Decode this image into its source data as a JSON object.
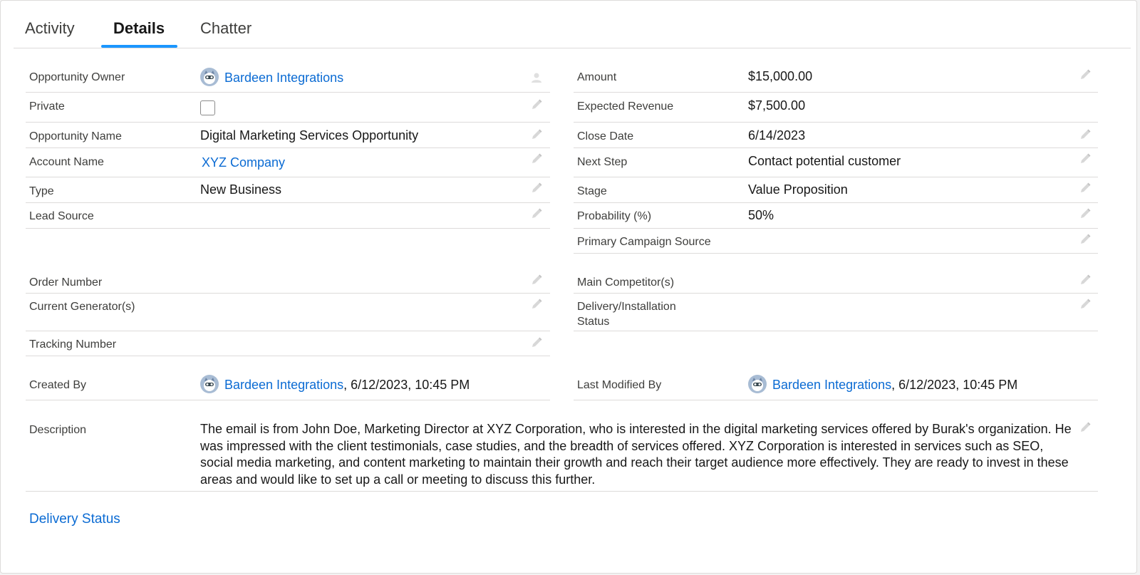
{
  "tabs": [
    {
      "label": "Activity"
    },
    {
      "label": "Details"
    },
    {
      "label": "Chatter"
    }
  ],
  "left": {
    "owner_label": "Opportunity Owner",
    "owner_value": "Bardeen Integrations",
    "private_label": "Private",
    "opp_name_label": "Opportunity Name",
    "opp_name_value": "Digital Marketing Services Opportunity",
    "account_label": "Account Name",
    "account_value": "XYZ Company",
    "type_label": "Type",
    "type_value": "New Business",
    "lead_label": "Lead Source",
    "lead_value": "",
    "order_label": "Order Number",
    "generator_label": "Current Generator(s)",
    "tracking_label": "Tracking Number"
  },
  "right": {
    "amount_label": "Amount",
    "amount_value": "$15,000.00",
    "expected_label": "Expected Revenue",
    "expected_value": "$7,500.00",
    "close_label": "Close Date",
    "close_value": "6/14/2023",
    "next_label": "Next Step",
    "next_value": "Contact potential customer",
    "stage_label": "Stage",
    "stage_value": "Value Proposition",
    "prob_label": "Probability (%)",
    "prob_value": "50%",
    "campaign_label": "Primary Campaign Source",
    "competitor_label": "Main Competitor(s)",
    "delivery_label_1": "Delivery/Installation",
    "delivery_label_2": "Status"
  },
  "system": {
    "created_label": "Created By",
    "created_user": "Bardeen Integrations",
    "created_date": ", 6/12/2023, 10:45 PM",
    "modified_label": "Last Modified By",
    "modified_user": "Bardeen Integrations",
    "modified_date": ", 6/12/2023, 10:45 PM"
  },
  "description": {
    "label": "Description",
    "value": "The email is from John Doe, Marketing Director at XYZ Corporation, who is interested in the digital marketing services offered by Burak's organization. He was impressed with the client testimonials, case studies, and the breadth of services offered. XYZ Corporation is interested in services such as SEO, social media marketing, and content marketing to maintain their growth and reach their target audience more effectively. They are ready to invest in these areas and would like to set up a call or meeting to discuss this further."
  },
  "section_delivery": "Delivery Status",
  "colors": {
    "link": "#0b6bd3",
    "tab_accent": "#1b96ff",
    "border": "#dddbda"
  }
}
